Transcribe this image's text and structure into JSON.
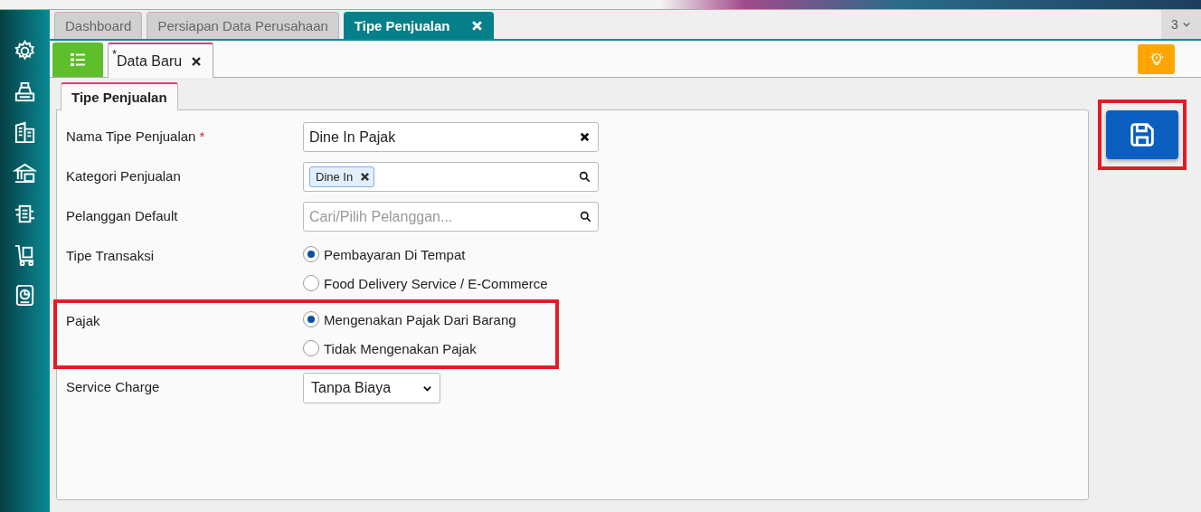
{
  "tabs": [
    {
      "label": "Dashboard",
      "selected": false,
      "closable": false
    },
    {
      "label": "Persiapan Data Perusahaan",
      "selected": false,
      "closable": false
    },
    {
      "label": "Tipe Penjualan",
      "selected": true,
      "closable": true
    }
  ],
  "tab_overflow": {
    "count": "3"
  },
  "document_tab": {
    "modified_mark": "*",
    "label": "Data Baru"
  },
  "section_tab": {
    "label": "Tipe Penjualan",
    "selected": true
  },
  "form": [
    {
      "kind": "text",
      "label": "Nama Tipe Penjualan",
      "required": true,
      "value": "Dine In Pajak",
      "highlighted": false
    },
    {
      "kind": "tags",
      "label": "Kategori Penjualan",
      "required": false,
      "tags": [
        "Dine In"
      ],
      "highlighted": false
    },
    {
      "kind": "search",
      "label": "Pelanggan Default",
      "required": false,
      "placeholder": "Cari/Pilih Pelanggan...",
      "highlighted": false
    },
    {
      "kind": "radio",
      "label": "Tipe Transaksi",
      "required": false,
      "highlighted": false,
      "options": [
        {
          "label": "Pembayaran Di Tempat",
          "selected": true
        },
        {
          "label": "Food Delivery Service / E-Commerce",
          "selected": false
        }
      ]
    },
    {
      "kind": "radio",
      "label": "Pajak",
      "required": false,
      "highlighted": true,
      "options": [
        {
          "label": "Mengenakan Pajak Dari Barang",
          "selected": true
        },
        {
          "label": "Tidak Mengenakan Pajak",
          "selected": false
        }
      ]
    },
    {
      "kind": "select",
      "label": "Service Charge",
      "required": false,
      "value": "Tanpa Biaya",
      "highlighted": false
    }
  ],
  "save_button": {
    "highlighted": true
  }
}
